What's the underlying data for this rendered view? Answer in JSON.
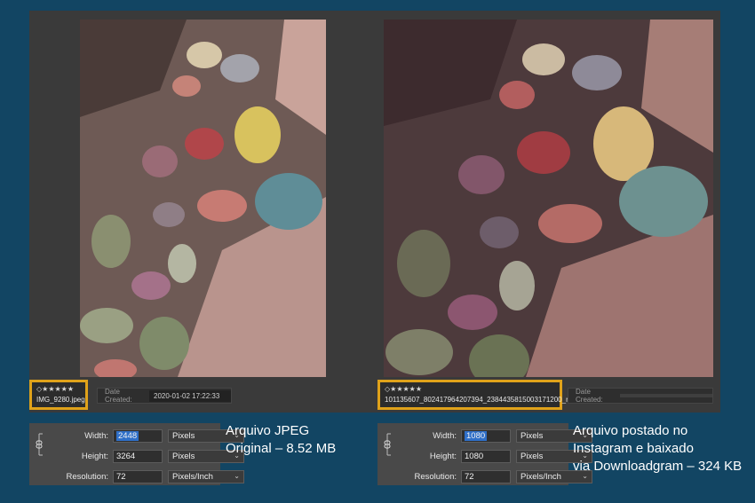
{
  "left": {
    "thumb": {
      "stars": "◇★★★★★",
      "filename": "IMG_9280.jpeg"
    },
    "date": {
      "label": "Date Created:",
      "value": "2020-01-02 17:22:33"
    },
    "dialog": {
      "width_label": "Width:",
      "width_value": "2448",
      "height_label": "Height:",
      "height_value": "3264",
      "resolution_label": "Resolution:",
      "resolution_value": "72",
      "unit_px": "Pixels",
      "unit_res": "Pixels/Inch"
    },
    "caption": [
      "Arquivo JPEG",
      "Original – 8.52 MB"
    ]
  },
  "right": {
    "thumb": {
      "stars": "◇★★★★★",
      "filename": "101135607_802417964207394_2384435815003171200_n.jpg"
    },
    "date": {
      "label": "Date Created:",
      "value": ""
    },
    "dialog": {
      "width_label": "Width:",
      "width_value": "1080",
      "height_label": "Height:",
      "height_value": "1080",
      "resolution_label": "Resolution:",
      "resolution_value": "72",
      "unit_px": "Pixels",
      "unit_res": "Pixels/Inch"
    },
    "caption": [
      "Arquivo postado no",
      "Instagram e baixado",
      "via Downloadgram – 324 KB"
    ]
  },
  "colors": {
    "background": "#124563",
    "highlight": "#e0a21a",
    "selection": "#2f6fc8"
  }
}
